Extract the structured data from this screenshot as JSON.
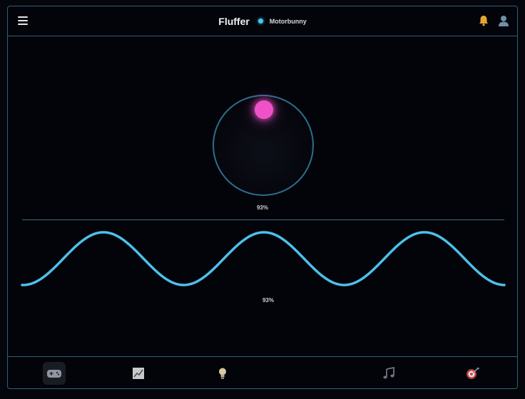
{
  "header": {
    "menu_icon": "hamburger-menu-icon",
    "title": "Fluffer",
    "device_name": "Motorbunny",
    "status_color": "#45c6f2",
    "notification_icon": "bell-icon",
    "profile_icon": "user-icon"
  },
  "orb": {
    "value_label": "93%",
    "value": 0.93,
    "ring_color": "#2b6e8c",
    "ball_color": "#ef52c8"
  },
  "wave": {
    "value_label": "93%",
    "value": 0.93,
    "color": "#4ec0ea"
  },
  "tabbar": {
    "items": [
      {
        "id": "game",
        "icon": "gamepad-icon",
        "active": true
      },
      {
        "id": "chart",
        "icon": "chart-icon",
        "active": false
      },
      {
        "id": "idea",
        "icon": "lightbulb-icon",
        "active": false
      },
      {
        "id": "music",
        "icon": "music-note-icon",
        "active": false
      },
      {
        "id": "target",
        "icon": "dart-target-icon",
        "active": false
      }
    ]
  }
}
